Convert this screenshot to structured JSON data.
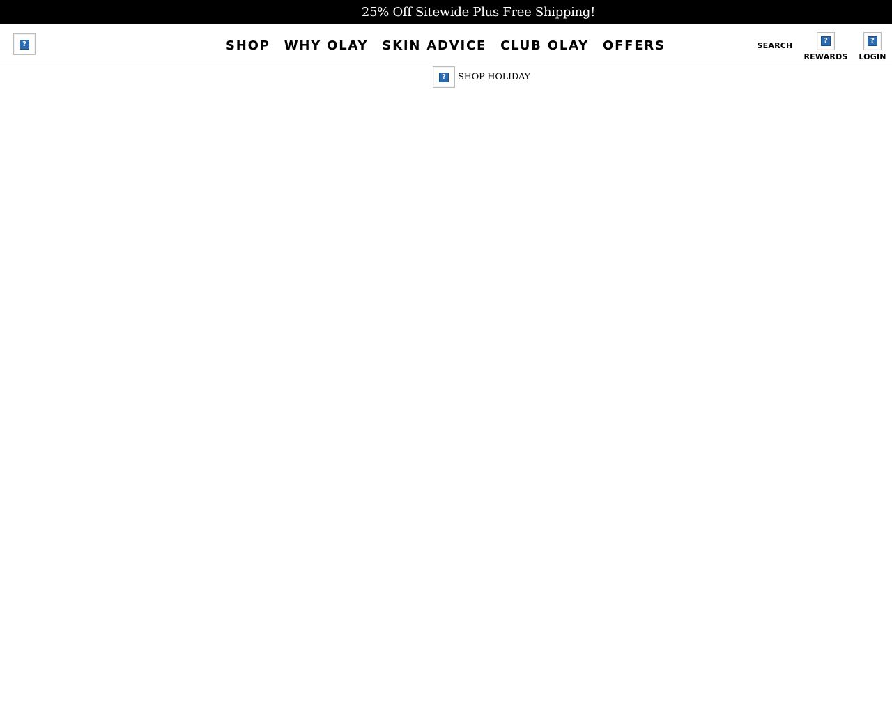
{
  "promo": {
    "text": "25% Off Sitewide Plus Free Shipping!"
  },
  "header": {
    "logo_icon": "broken-image-icon",
    "nav": [
      {
        "label": "SHOP"
      },
      {
        "label": "WHY OLAY"
      },
      {
        "label": "SKIN ADVICE"
      },
      {
        "label": "CLUB OLAY"
      },
      {
        "label": "OFFERS"
      }
    ],
    "utility": {
      "search_label": "SEARCH",
      "rewards_label": "REWARDS",
      "rewards_icon": "broken-image-icon",
      "login_label": "LOGIN",
      "login_icon": "broken-image-icon"
    }
  },
  "subnav": {
    "label": "SHOP HOLIDAY",
    "icon": "broken-image-icon"
  },
  "colors": {
    "promo_background": "#000000",
    "promo_text": "#ffffff",
    "header_border": "#6e6e6e",
    "page_background": "#ffffff"
  }
}
